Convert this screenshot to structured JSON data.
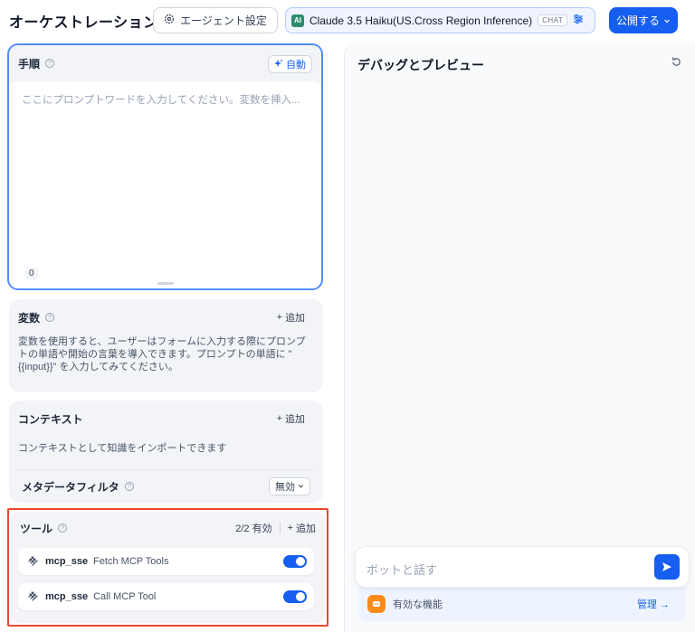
{
  "header": {
    "title": "オーケストレーション",
    "agent_settings_label": "エージェント設定",
    "model": {
      "name": "Claude 3.5 Haiku(US.Cross Region Inference)",
      "badge": "CHAT"
    },
    "publish_label": "公開する"
  },
  "instructions": {
    "title": "手順",
    "auto_label": "自動",
    "placeholder": "ここにプロンプトワードを入力してください。変数を挿入...",
    "char_count": "0"
  },
  "variables": {
    "title": "変数",
    "add_label": "追加",
    "description": "変数を使用すると、ユーザーはフォームに入力する際にプロンプトの単語や開始の言葉を導入できます。プロンプトの単語に \"{{input}}\" を入力してみてください。"
  },
  "context": {
    "title": "コンテキスト",
    "add_label": "追加",
    "description": "コンテキストとして知識をインポートできます",
    "metadata_filter": {
      "title": "メタデータフィルタ",
      "value": "無効"
    }
  },
  "tools": {
    "title": "ツール",
    "enabled_count": "2/2 有効",
    "add_label": "追加",
    "items": [
      {
        "provider": "mcp_sse",
        "name": "Fetch MCP Tools",
        "enabled": true
      },
      {
        "provider": "mcp_sse",
        "name": "Call MCP Tool",
        "enabled": true
      }
    ]
  },
  "debug": {
    "title": "デバッグとプレビュー",
    "chat_placeholder": "ボットと話す",
    "features_label": "有効な機能",
    "manage_label": "管理 →"
  },
  "colors": {
    "accent": "#155eef",
    "highlight_border": "#e8482f",
    "feature_icon": "#fb8c1c"
  }
}
